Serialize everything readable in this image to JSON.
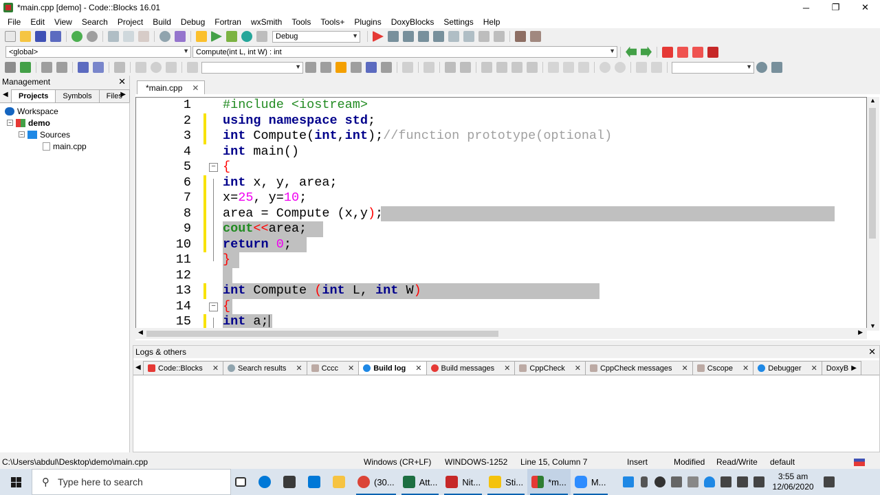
{
  "window": {
    "title": "*main.cpp [demo] - Code::Blocks 16.01",
    "minimize": "─",
    "restore": "❐",
    "close": "✕"
  },
  "menu": [
    "File",
    "Edit",
    "View",
    "Search",
    "Project",
    "Build",
    "Debug",
    "Fortran",
    "wxSmith",
    "Tools",
    "Tools+",
    "Plugins",
    "DoxyBlocks",
    "Settings",
    "Help"
  ],
  "toolbar": {
    "build_target": "Debug",
    "scope": "<global>",
    "function": "Compute(int L, int W) : int"
  },
  "management": {
    "title": "Management",
    "tabs": [
      "Projects",
      "Symbols",
      "Files"
    ],
    "tree": [
      {
        "label": "Workspace",
        "level": 0
      },
      {
        "label": "demo",
        "level": 1
      },
      {
        "label": "Sources",
        "level": 2
      },
      {
        "label": "main.cpp",
        "level": 3
      }
    ]
  },
  "editor": {
    "tab_label": "*main.cpp",
    "line_numbers": [
      "1",
      "2",
      "3",
      "4",
      "5",
      "6",
      "7",
      "8",
      "9",
      "10",
      "11",
      "12",
      "13",
      "14",
      "15"
    ]
  },
  "logs": {
    "title": "Logs & others",
    "tabs": [
      "Code::Blocks",
      "Search results",
      "Cccc",
      "Build log",
      "Build messages",
      "CppCheck",
      "CppCheck messages",
      "Cscope",
      "Debugger",
      "DoxyB"
    ],
    "active_tab": "Build log"
  },
  "status": {
    "path": "C:\\Users\\abdul\\Desktop\\demo\\main.cpp",
    "eol": "Windows (CR+LF)",
    "encoding": "WINDOWS-1252",
    "position": "Line 15, Column 7",
    "mode": "Insert",
    "modified": "Modified",
    "access": "Read/Write",
    "profile": "default"
  },
  "taskbar": {
    "search_placeholder": "Type here to search",
    "apps": [
      {
        "label": "(30...",
        "color": "#db4437"
      },
      {
        "label": "Att...",
        "color": "#1d6f42"
      },
      {
        "label": "Nit...",
        "color": "#c62828"
      },
      {
        "label": "Sti...",
        "color": "#f4c20d"
      },
      {
        "label": "*m...",
        "color": "#2e7d32"
      },
      {
        "label": "M...",
        "color": "#2d8cff"
      }
    ],
    "time": "3:55 am",
    "date": "12/06/2020"
  },
  "colors": {
    "keyword": "#00008b",
    "preprocessor": "#228b22",
    "number": "#f000f0",
    "selection": "#c0c0c0",
    "change_marker": "#f8e200"
  }
}
